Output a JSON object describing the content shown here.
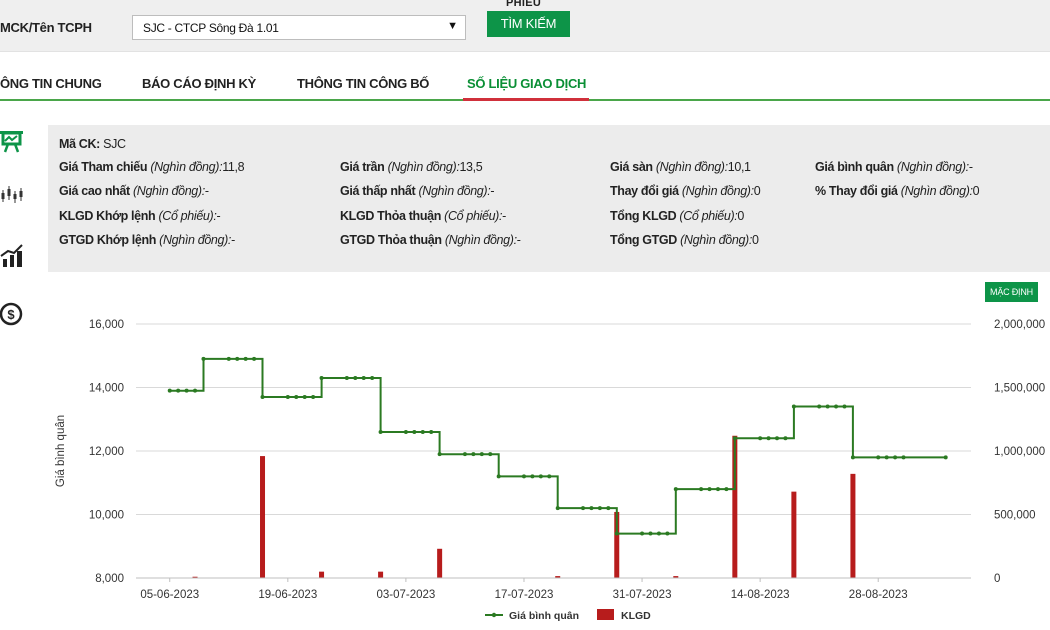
{
  "search": {
    "label": "MCK/Tên TCPH",
    "selected_value": "SJC - CTCP Sông Đà 1.01",
    "top_cut_text": "PHIẾU",
    "button_label": "TÌM KIẾM"
  },
  "tabs": [
    {
      "label": "ÔNG TIN CHUNG",
      "active": false
    },
    {
      "label": "BÁO CÁO ĐỊNH KỲ",
      "active": false
    },
    {
      "label": "THÔNG TIN CÔNG BỐ",
      "active": false
    },
    {
      "label": "SỐ LIỆU GIAO DỊCH",
      "active": true
    }
  ],
  "side_icons": [
    "board-chart-icon",
    "candlestick-icon",
    "bar-line-chart-icon",
    "dollar-circle-icon"
  ],
  "info": {
    "ma_ck": {
      "label": "Mã CK:",
      "value": "SJC"
    },
    "rows": [
      [
        {
          "label": "Giá Tham chiếu",
          "unit": "(Nghìn đồng):",
          "value": "11,8"
        },
        {
          "label": "Giá trần",
          "unit": "(Nghìn đồng):",
          "value": "13,5"
        },
        {
          "label": "Giá sàn",
          "unit": "(Nghìn đồng):",
          "value": "10,1"
        },
        {
          "label": "Giá bình quân",
          "unit": "(Nghìn đồng):",
          "value": "-"
        }
      ],
      [
        {
          "label": "Giá cao nhất",
          "unit": "(Nghìn đồng):",
          "value": "-"
        },
        {
          "label": "Giá thấp nhất",
          "unit": "(Nghìn đồng):",
          "value": "-"
        },
        {
          "label": "Thay đổi giá",
          "unit": "(Nghìn đồng):",
          "value": "0"
        },
        {
          "label": "% Thay đổi giá",
          "unit": "(Nghìn đồng):",
          "value": "0"
        }
      ],
      [
        {
          "label": "KLGD Khớp lệnh",
          "unit": "(Cổ phiếu):",
          "value": "-"
        },
        {
          "label": "KLGD Thỏa thuận",
          "unit": "(Cổ phiếu):",
          "value": "-"
        },
        {
          "label": "Tổng KLGD",
          "unit": "(Cổ phiếu):",
          "value": "0"
        }
      ],
      [
        {
          "label": "GTGD Khớp lệnh",
          "unit": "(Nghìn đồng):",
          "value": "-"
        },
        {
          "label": "GTGD Thỏa thuận",
          "unit": "(Nghìn đồng):",
          "value": "-"
        },
        {
          "label": "Tổng GTGD",
          "unit": "(Nghìn đồng):",
          "value": "0"
        }
      ]
    ]
  },
  "chart": {
    "default_button": "MẶC ĐỊNH"
  },
  "colors": {
    "brand_green": "#0d9448",
    "price_line": "#2b7a22",
    "volume_bar": "#b71c1c",
    "active_tab_text": "#0a8f35",
    "active_tab_underline": "#d0303b",
    "panel_bg": "#ececec"
  },
  "chart_data": {
    "type": "line",
    "ylabel": "Giá bình quân",
    "y_left_ticks": [
      "8,000",
      "10,000",
      "12,000",
      "14,000",
      "16,000"
    ],
    "y_left_range": [
      8000,
      16000
    ],
    "y_right_ticks": [
      "0",
      "500,000",
      "1,000,000",
      "1,500,000",
      "2,000,000"
    ],
    "y_right_range": [
      0,
      2000000
    ],
    "x_ticks": [
      "05-06-2023",
      "19-06-2023",
      "03-07-2023",
      "17-07-2023",
      "31-07-2023",
      "14-08-2023",
      "28-08-2023"
    ],
    "grid": "horizontal",
    "legend_position": "bottom",
    "series": [
      {
        "name": "Giá bình quân",
        "axis": "left",
        "kind": "line",
        "color": "#2b7a22",
        "points": [
          [
            "05-06-2023",
            13900
          ],
          [
            "06-06-2023",
            13900
          ],
          [
            "07-06-2023",
            13900
          ],
          [
            "08-06-2023",
            13900
          ],
          [
            "09-06-2023",
            14900
          ],
          [
            "12-06-2023",
            14900
          ],
          [
            "13-06-2023",
            14900
          ],
          [
            "14-06-2023",
            14900
          ],
          [
            "15-06-2023",
            14900
          ],
          [
            "16-06-2023",
            13700
          ],
          [
            "19-06-2023",
            13700
          ],
          [
            "20-06-2023",
            13700
          ],
          [
            "21-06-2023",
            13700
          ],
          [
            "22-06-2023",
            13700
          ],
          [
            "23-06-2023",
            14300
          ],
          [
            "26-06-2023",
            14300
          ],
          [
            "27-06-2023",
            14300
          ],
          [
            "28-06-2023",
            14300
          ],
          [
            "29-06-2023",
            14300
          ],
          [
            "30-06-2023",
            12600
          ],
          [
            "03-07-2023",
            12600
          ],
          [
            "04-07-2023",
            12600
          ],
          [
            "05-07-2023",
            12600
          ],
          [
            "06-07-2023",
            12600
          ],
          [
            "07-07-2023",
            11900
          ],
          [
            "10-07-2023",
            11900
          ],
          [
            "11-07-2023",
            11900
          ],
          [
            "12-07-2023",
            11900
          ],
          [
            "13-07-2023",
            11900
          ],
          [
            "14-07-2023",
            11200
          ],
          [
            "17-07-2023",
            11200
          ],
          [
            "18-07-2023",
            11200
          ],
          [
            "19-07-2023",
            11200
          ],
          [
            "20-07-2023",
            11200
          ],
          [
            "21-07-2023",
            10200
          ],
          [
            "24-07-2023",
            10200
          ],
          [
            "25-07-2023",
            10200
          ],
          [
            "26-07-2023",
            10200
          ],
          [
            "27-07-2023",
            10200
          ],
          [
            "28-07-2023",
            9400
          ],
          [
            "31-07-2023",
            9400
          ],
          [
            "01-08-2023",
            9400
          ],
          [
            "02-08-2023",
            9400
          ],
          [
            "03-08-2023",
            9400
          ],
          [
            "04-08-2023",
            10800
          ],
          [
            "07-08-2023",
            10800
          ],
          [
            "08-08-2023",
            10800
          ],
          [
            "09-08-2023",
            10800
          ],
          [
            "10-08-2023",
            10800
          ],
          [
            "11-08-2023",
            12400
          ],
          [
            "14-08-2023",
            12400
          ],
          [
            "15-08-2023",
            12400
          ],
          [
            "16-08-2023",
            12400
          ],
          [
            "17-08-2023",
            12400
          ],
          [
            "18-08-2023",
            13400
          ],
          [
            "21-08-2023",
            13400
          ],
          [
            "22-08-2023",
            13400
          ],
          [
            "23-08-2023",
            13400
          ],
          [
            "24-08-2023",
            13400
          ],
          [
            "25-08-2023",
            11800
          ],
          [
            "28-08-2023",
            11800
          ],
          [
            "29-08-2023",
            11800
          ],
          [
            "30-08-2023",
            11800
          ],
          [
            "31-08-2023",
            11800
          ],
          [
            "05-09-2023",
            11800
          ]
        ]
      },
      {
        "name": "KLGD",
        "axis": "right",
        "kind": "bar",
        "color": "#b71c1c",
        "points": [
          [
            "08-06-2023",
            10000
          ],
          [
            "16-06-2023",
            960000
          ],
          [
            "23-06-2023",
            50000
          ],
          [
            "30-06-2023",
            50000
          ],
          [
            "07-07-2023",
            230000
          ],
          [
            "21-07-2023",
            15000
          ],
          [
            "28-07-2023",
            520000
          ],
          [
            "04-08-2023",
            15000
          ],
          [
            "11-08-2023",
            1120000
          ],
          [
            "18-08-2023",
            680000
          ],
          [
            "25-08-2023",
            820000
          ]
        ]
      }
    ]
  }
}
